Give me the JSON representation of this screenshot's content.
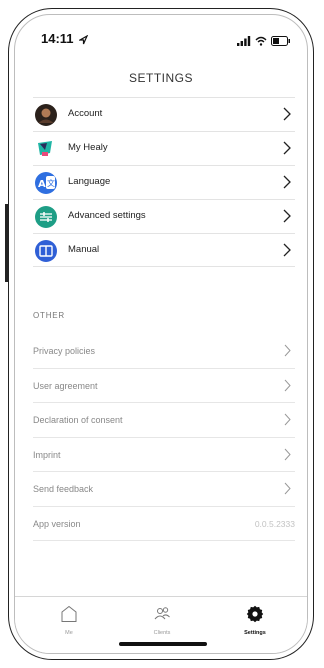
{
  "status_bar": {
    "time": "14:11"
  },
  "header": {
    "title": "SETTINGS"
  },
  "main_list": [
    {
      "label": "Account",
      "icon": "avatar-icon",
      "color": "#3a2a20"
    },
    {
      "label": "My Healy",
      "icon": "device-icon",
      "color": "#2ec4b6"
    },
    {
      "label": "Language",
      "icon": "translate-icon",
      "color": "#2f6fe0"
    },
    {
      "label": "Advanced settings",
      "icon": "sliders-icon",
      "color": "#1e9e86"
    },
    {
      "label": "Manual",
      "icon": "book-icon",
      "color": "#2f5fd6"
    }
  ],
  "other": {
    "heading": "OTHER",
    "items": [
      {
        "label": "Privacy policies"
      },
      {
        "label": "User agreement"
      },
      {
        "label": "Declaration of consent"
      },
      {
        "label": "Imprint"
      },
      {
        "label": "Send feedback"
      }
    ],
    "app_version_label": "App version",
    "app_version_value": "0.0.5.2333"
  },
  "tab_bar": {
    "tabs": [
      {
        "label": "Me",
        "icon": "home-icon",
        "active": false
      },
      {
        "label": "Clients",
        "icon": "users-icon",
        "active": false
      },
      {
        "label": "Settings",
        "icon": "gear-icon",
        "active": true
      }
    ]
  }
}
